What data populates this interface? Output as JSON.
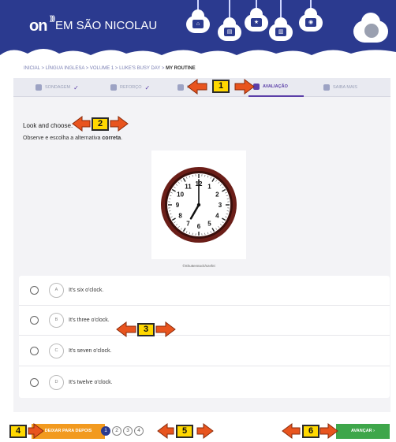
{
  "header": {
    "logo": "on",
    "school_name": "EM SÃO NICOLAU"
  },
  "breadcrumb": {
    "items": [
      "INICIAL",
      "LÍNGUA INGLESA",
      "VOLUME 1",
      "LUKE'S BUSY DAY"
    ],
    "current": "MY ROUTINE",
    "separator": ">"
  },
  "tabs": [
    {
      "label": "SONDAGEM",
      "done": true
    },
    {
      "label": "REFORÇO",
      "done": true
    },
    {
      "label": "DI",
      "done": false
    },
    {
      "label": "AVALIAÇÃO",
      "active": true
    },
    {
      "label": "SAIBA MAIS",
      "done": false
    }
  ],
  "question": {
    "title": "Look and choose.",
    "instruction_prefix": "Observe e escolha a alternativa",
    "instruction_emphasis": "correta",
    "credit": "©Shutterstock/szefei"
  },
  "clock": {
    "hour_numbers": [
      "12",
      "1",
      "2",
      "3",
      "4",
      "5",
      "6",
      "7",
      "8",
      "9",
      "10",
      "11"
    ],
    "hour": 7,
    "minute": 0
  },
  "options": [
    {
      "letter": "A",
      "text": "It's six o'clock."
    },
    {
      "letter": "B",
      "text": "It's three o'clock."
    },
    {
      "letter": "C",
      "text": "It's seven o'clock."
    },
    {
      "letter": "D",
      "text": "It's twelve o'clock."
    }
  ],
  "footer": {
    "later_label": "DEIXAR PARA DEPOIS",
    "pages": [
      "1",
      "2",
      "3",
      "4"
    ],
    "current_page": "1",
    "next_label": "AVANÇAR  ›"
  },
  "callouts": [
    "1",
    "2",
    "3",
    "4",
    "5",
    "6"
  ],
  "colors": {
    "header_bg": "#2b3a8f",
    "active_tab": "#5b3fa8",
    "later_button": "#f29a1f",
    "next_button": "#3ea64a",
    "callout_fill": "#ffd800",
    "callout_arrow": "#e8541e"
  }
}
